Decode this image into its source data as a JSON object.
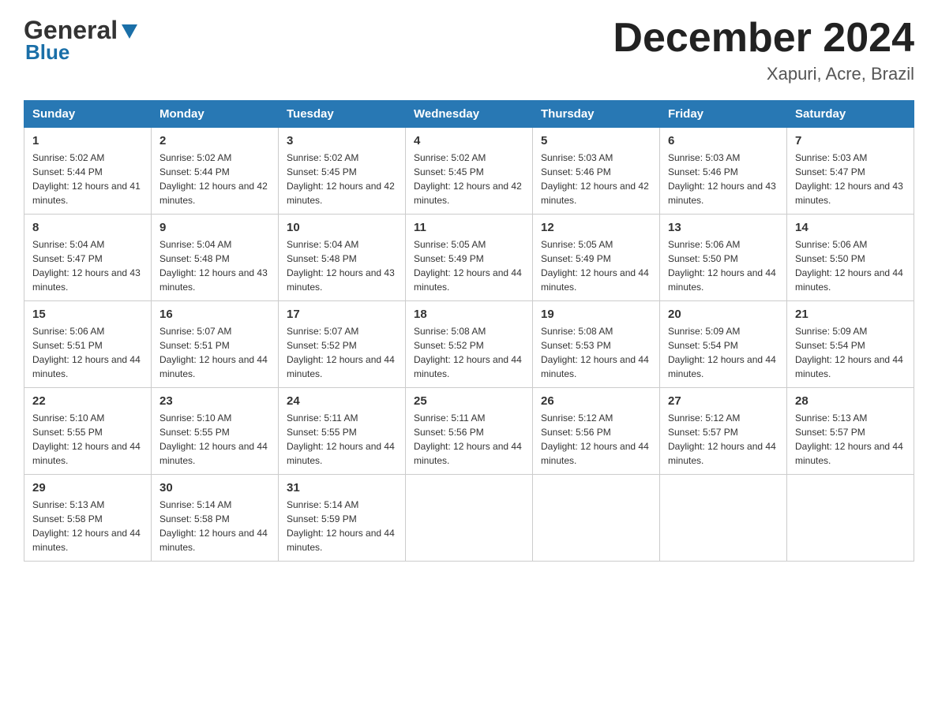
{
  "header": {
    "logo_general": "General",
    "logo_blue": "Blue",
    "month_title": "December 2024",
    "location": "Xapuri, Acre, Brazil"
  },
  "days_of_week": [
    "Sunday",
    "Monday",
    "Tuesday",
    "Wednesday",
    "Thursday",
    "Friday",
    "Saturday"
  ],
  "weeks": [
    [
      {
        "day": "1",
        "sunrise": "Sunrise: 5:02 AM",
        "sunset": "Sunset: 5:44 PM",
        "daylight": "Daylight: 12 hours and 41 minutes."
      },
      {
        "day": "2",
        "sunrise": "Sunrise: 5:02 AM",
        "sunset": "Sunset: 5:44 PM",
        "daylight": "Daylight: 12 hours and 42 minutes."
      },
      {
        "day": "3",
        "sunrise": "Sunrise: 5:02 AM",
        "sunset": "Sunset: 5:45 PM",
        "daylight": "Daylight: 12 hours and 42 minutes."
      },
      {
        "day": "4",
        "sunrise": "Sunrise: 5:02 AM",
        "sunset": "Sunset: 5:45 PM",
        "daylight": "Daylight: 12 hours and 42 minutes."
      },
      {
        "day": "5",
        "sunrise": "Sunrise: 5:03 AM",
        "sunset": "Sunset: 5:46 PM",
        "daylight": "Daylight: 12 hours and 42 minutes."
      },
      {
        "day": "6",
        "sunrise": "Sunrise: 5:03 AM",
        "sunset": "Sunset: 5:46 PM",
        "daylight": "Daylight: 12 hours and 43 minutes."
      },
      {
        "day": "7",
        "sunrise": "Sunrise: 5:03 AM",
        "sunset": "Sunset: 5:47 PM",
        "daylight": "Daylight: 12 hours and 43 minutes."
      }
    ],
    [
      {
        "day": "8",
        "sunrise": "Sunrise: 5:04 AM",
        "sunset": "Sunset: 5:47 PM",
        "daylight": "Daylight: 12 hours and 43 minutes."
      },
      {
        "day": "9",
        "sunrise": "Sunrise: 5:04 AM",
        "sunset": "Sunset: 5:48 PM",
        "daylight": "Daylight: 12 hours and 43 minutes."
      },
      {
        "day": "10",
        "sunrise": "Sunrise: 5:04 AM",
        "sunset": "Sunset: 5:48 PM",
        "daylight": "Daylight: 12 hours and 43 minutes."
      },
      {
        "day": "11",
        "sunrise": "Sunrise: 5:05 AM",
        "sunset": "Sunset: 5:49 PM",
        "daylight": "Daylight: 12 hours and 44 minutes."
      },
      {
        "day": "12",
        "sunrise": "Sunrise: 5:05 AM",
        "sunset": "Sunset: 5:49 PM",
        "daylight": "Daylight: 12 hours and 44 minutes."
      },
      {
        "day": "13",
        "sunrise": "Sunrise: 5:06 AM",
        "sunset": "Sunset: 5:50 PM",
        "daylight": "Daylight: 12 hours and 44 minutes."
      },
      {
        "day": "14",
        "sunrise": "Sunrise: 5:06 AM",
        "sunset": "Sunset: 5:50 PM",
        "daylight": "Daylight: 12 hours and 44 minutes."
      }
    ],
    [
      {
        "day": "15",
        "sunrise": "Sunrise: 5:06 AM",
        "sunset": "Sunset: 5:51 PM",
        "daylight": "Daylight: 12 hours and 44 minutes."
      },
      {
        "day": "16",
        "sunrise": "Sunrise: 5:07 AM",
        "sunset": "Sunset: 5:51 PM",
        "daylight": "Daylight: 12 hours and 44 minutes."
      },
      {
        "day": "17",
        "sunrise": "Sunrise: 5:07 AM",
        "sunset": "Sunset: 5:52 PM",
        "daylight": "Daylight: 12 hours and 44 minutes."
      },
      {
        "day": "18",
        "sunrise": "Sunrise: 5:08 AM",
        "sunset": "Sunset: 5:52 PM",
        "daylight": "Daylight: 12 hours and 44 minutes."
      },
      {
        "day": "19",
        "sunrise": "Sunrise: 5:08 AM",
        "sunset": "Sunset: 5:53 PM",
        "daylight": "Daylight: 12 hours and 44 minutes."
      },
      {
        "day": "20",
        "sunrise": "Sunrise: 5:09 AM",
        "sunset": "Sunset: 5:54 PM",
        "daylight": "Daylight: 12 hours and 44 minutes."
      },
      {
        "day": "21",
        "sunrise": "Sunrise: 5:09 AM",
        "sunset": "Sunset: 5:54 PM",
        "daylight": "Daylight: 12 hours and 44 minutes."
      }
    ],
    [
      {
        "day": "22",
        "sunrise": "Sunrise: 5:10 AM",
        "sunset": "Sunset: 5:55 PM",
        "daylight": "Daylight: 12 hours and 44 minutes."
      },
      {
        "day": "23",
        "sunrise": "Sunrise: 5:10 AM",
        "sunset": "Sunset: 5:55 PM",
        "daylight": "Daylight: 12 hours and 44 minutes."
      },
      {
        "day": "24",
        "sunrise": "Sunrise: 5:11 AM",
        "sunset": "Sunset: 5:55 PM",
        "daylight": "Daylight: 12 hours and 44 minutes."
      },
      {
        "day": "25",
        "sunrise": "Sunrise: 5:11 AM",
        "sunset": "Sunset: 5:56 PM",
        "daylight": "Daylight: 12 hours and 44 minutes."
      },
      {
        "day": "26",
        "sunrise": "Sunrise: 5:12 AM",
        "sunset": "Sunset: 5:56 PM",
        "daylight": "Daylight: 12 hours and 44 minutes."
      },
      {
        "day": "27",
        "sunrise": "Sunrise: 5:12 AM",
        "sunset": "Sunset: 5:57 PM",
        "daylight": "Daylight: 12 hours and 44 minutes."
      },
      {
        "day": "28",
        "sunrise": "Sunrise: 5:13 AM",
        "sunset": "Sunset: 5:57 PM",
        "daylight": "Daylight: 12 hours and 44 minutes."
      }
    ],
    [
      {
        "day": "29",
        "sunrise": "Sunrise: 5:13 AM",
        "sunset": "Sunset: 5:58 PM",
        "daylight": "Daylight: 12 hours and 44 minutes."
      },
      {
        "day": "30",
        "sunrise": "Sunrise: 5:14 AM",
        "sunset": "Sunset: 5:58 PM",
        "daylight": "Daylight: 12 hours and 44 minutes."
      },
      {
        "day": "31",
        "sunrise": "Sunrise: 5:14 AM",
        "sunset": "Sunset: 5:59 PM",
        "daylight": "Daylight: 12 hours and 44 minutes."
      },
      null,
      null,
      null,
      null
    ]
  ]
}
